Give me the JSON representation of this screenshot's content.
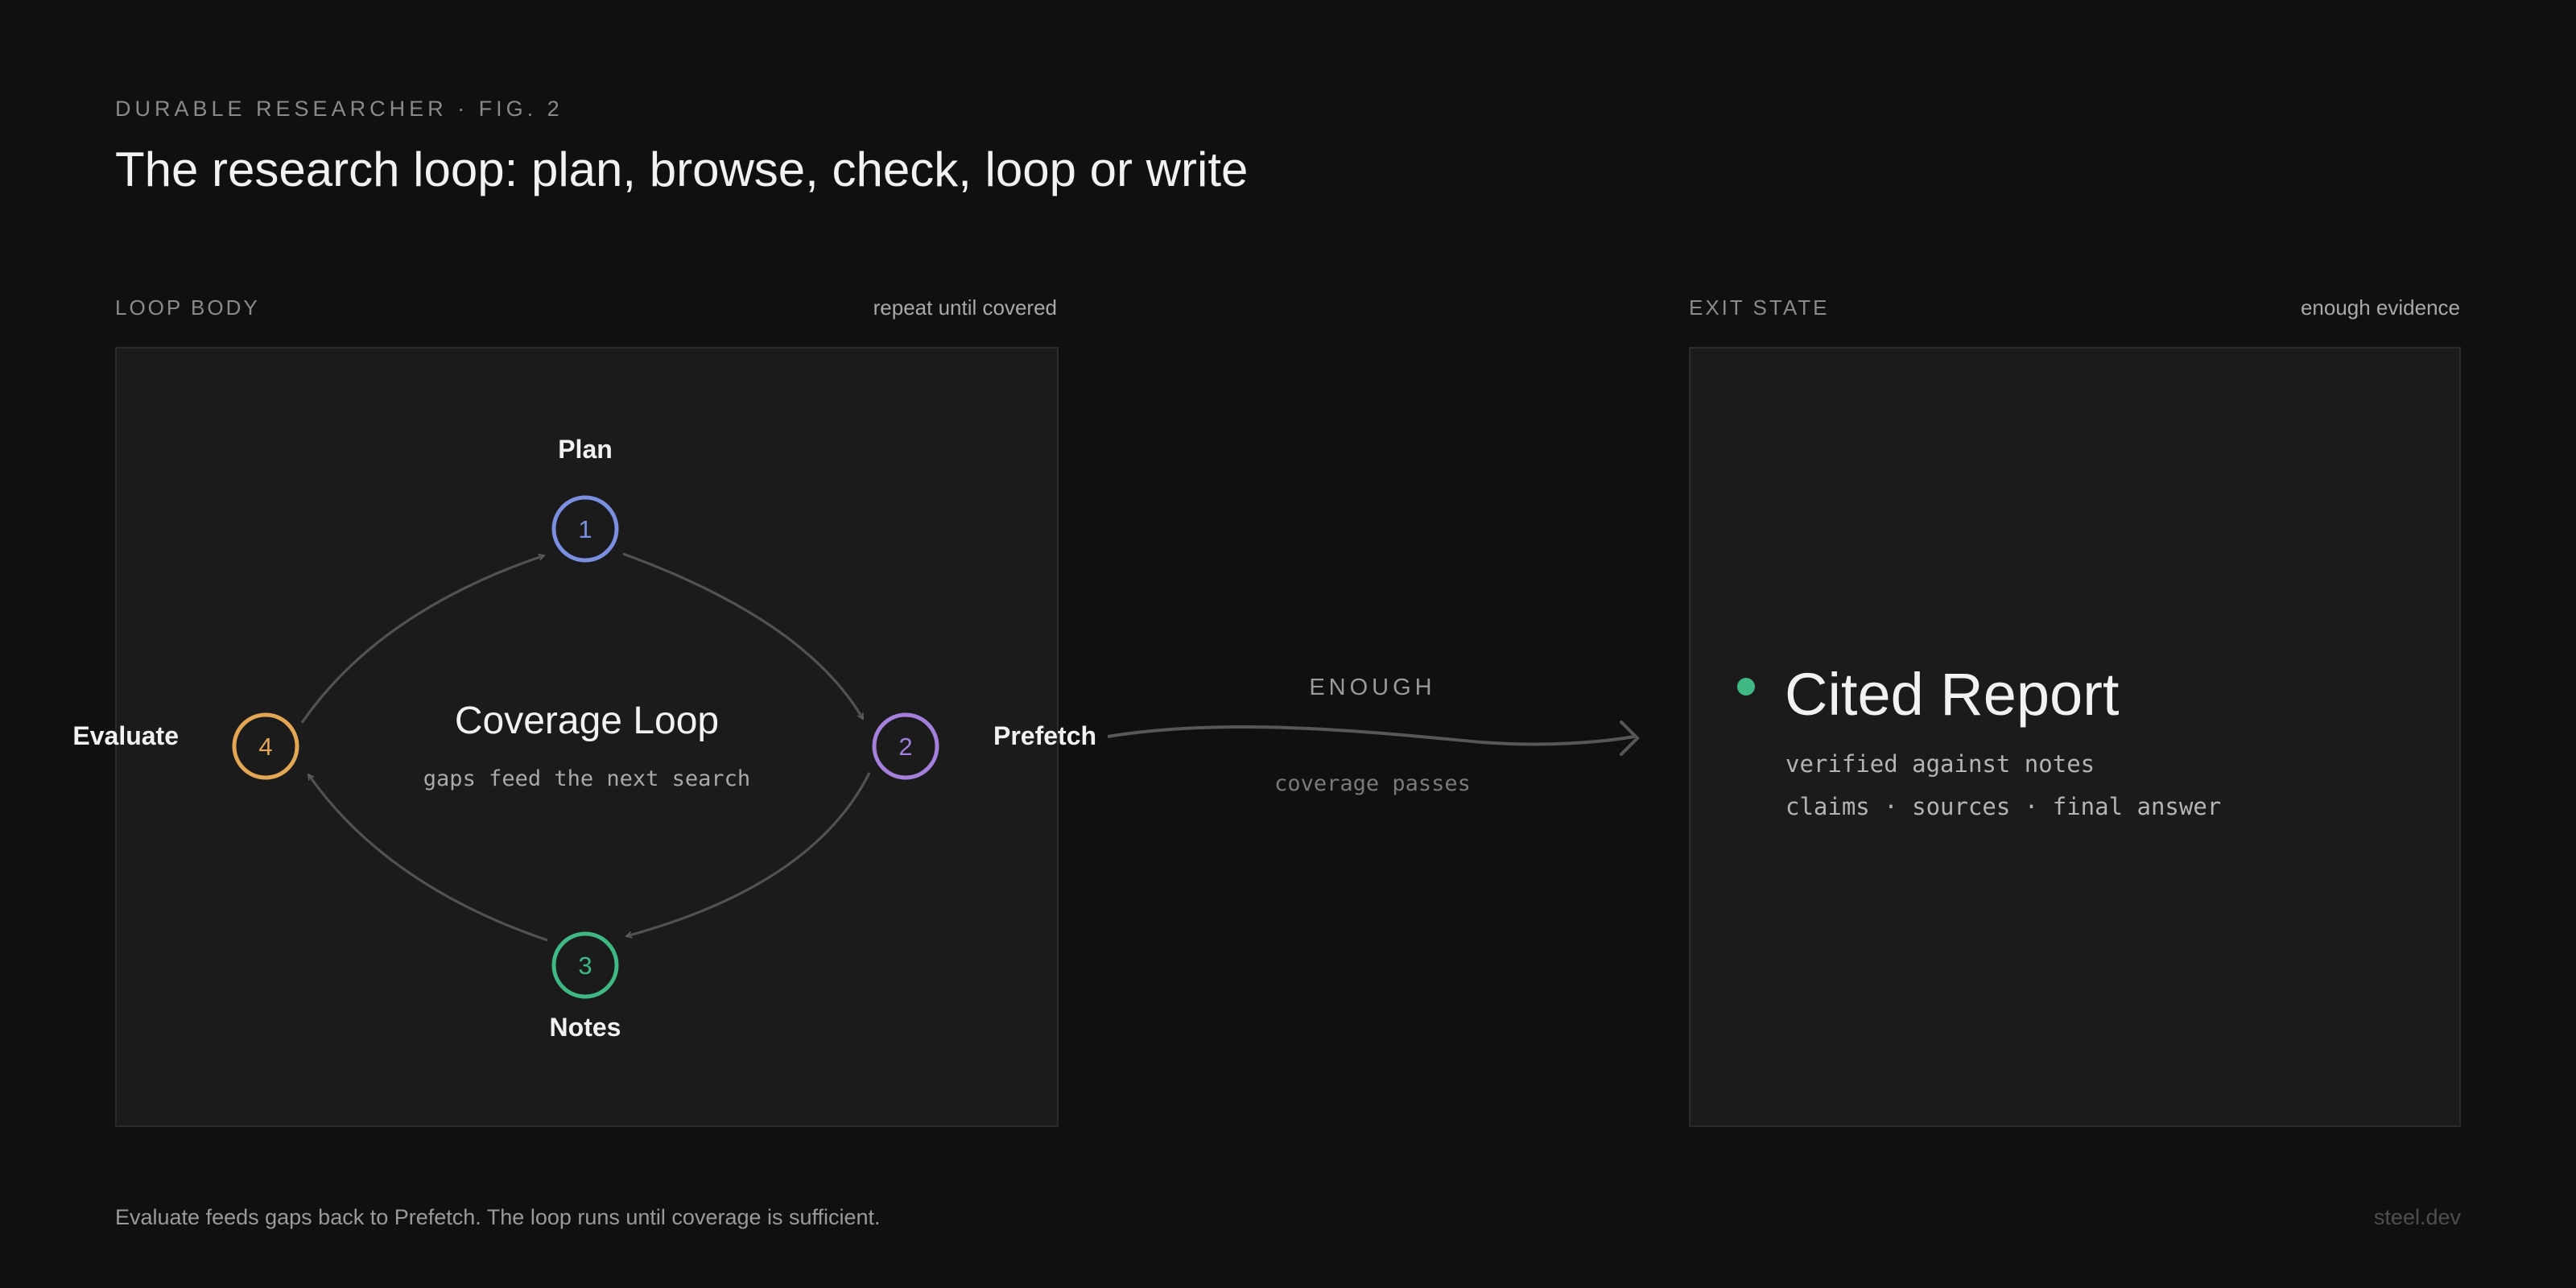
{
  "header": {
    "eyebrow": "DURABLE RESEARCHER · FIG. 2",
    "title": "The research loop: plan, browse, check, loop or write"
  },
  "loop_panel": {
    "label": "LOOP BODY",
    "note": "repeat until covered",
    "center_title": "Coverage Loop",
    "center_subtitle": "gaps feed the next search",
    "nodes": [
      {
        "number": "1",
        "label": "Plan",
        "color": "#7b8fe0"
      },
      {
        "number": "2",
        "label": "Prefetch",
        "color": "#a57fdc"
      },
      {
        "number": "3",
        "label": "Notes",
        "color": "#3fb883"
      },
      {
        "number": "4",
        "label": "Evaluate",
        "color": "#e3a754"
      }
    ]
  },
  "transition": {
    "label": "ENOUGH",
    "sublabel": "coverage passes"
  },
  "exit_panel": {
    "label": "EXIT STATE",
    "note": "enough evidence",
    "title": "Cited Report",
    "line1": "verified against notes",
    "line2": "claims · sources · final answer",
    "dot_color": "#3fb883"
  },
  "footer": {
    "caption": "Evaluate feeds gaps back to Prefetch. The loop runs until coverage is sufficient.",
    "brand": "steel.dev"
  }
}
